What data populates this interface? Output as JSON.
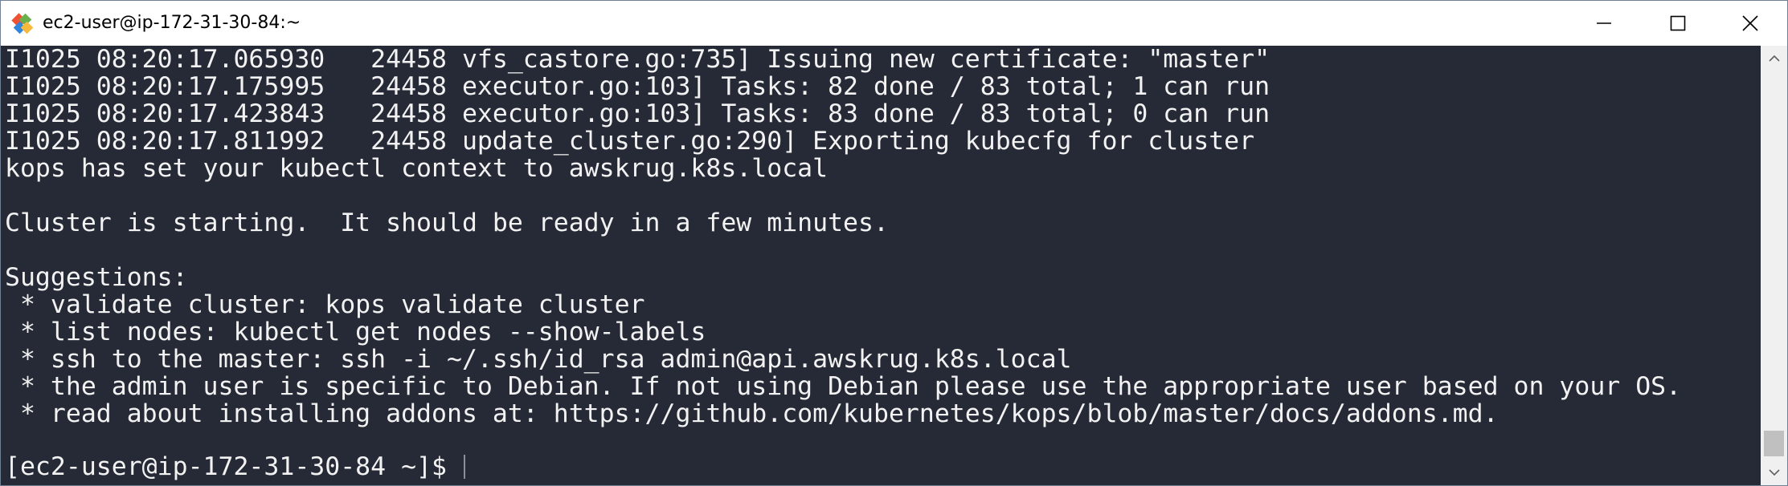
{
  "window": {
    "title": "ec2-user@ip-172-31-30-84:~",
    "app_icon": "git-bash-icon",
    "controls": [
      "minimize-icon",
      "maximize-icon",
      "close-icon"
    ]
  },
  "terminal": {
    "lines": [
      "I1025 08:20:17.065930   24458 vfs_castore.go:735] Issuing new certificate: \"master\"",
      "I1025 08:20:17.175995   24458 executor.go:103] Tasks: 82 done / 83 total; 1 can run",
      "I1025 08:20:17.423843   24458 executor.go:103] Tasks: 83 done / 83 total; 0 can run",
      "I1025 08:20:17.811992   24458 update_cluster.go:290] Exporting kubecfg for cluster",
      "kops has set your kubectl context to awskrug.k8s.local",
      "",
      "Cluster is starting.  It should be ready in a few minutes.",
      "",
      "Suggestions:",
      " * validate cluster: kops validate cluster",
      " * list nodes: kubectl get nodes --show-labels",
      " * ssh to the master: ssh -i ~/.ssh/id_rsa admin@api.awskrug.k8s.local",
      " * the admin user is specific to Debian. If not using Debian please use the appropriate user based on your OS.",
      " * read about installing addons at: https://github.com/kubernetes/kops/blob/master/docs/addons.md.",
      ""
    ],
    "prompt": "[ec2-user@ip-172-31-30-84 ~]$ ",
    "background_color": "#262a36",
    "text_color": "#f2f2f2"
  },
  "scrollbar": {
    "position": 1.0
  }
}
